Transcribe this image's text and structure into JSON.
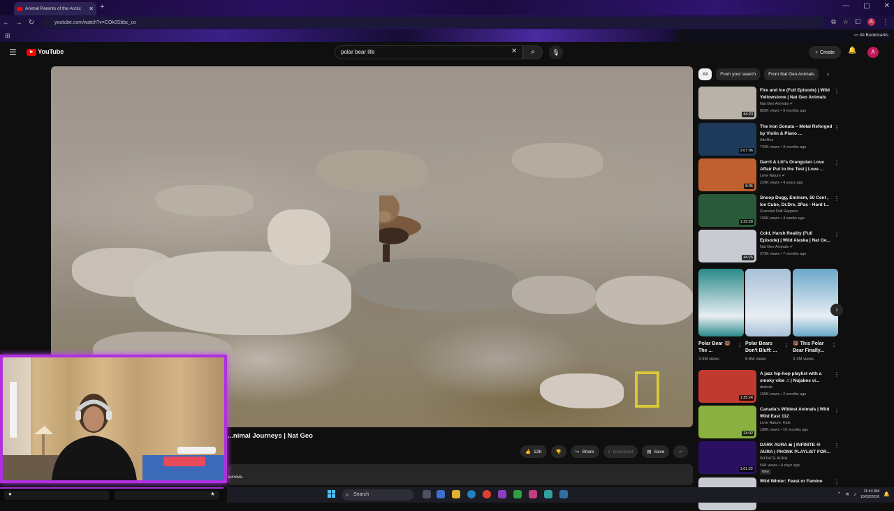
{
  "browser": {
    "tab_title": "Animal Parents of the Arctic",
    "url": "youtube.com/watch?v=COk0Sbbc_co",
    "bookmarks_label": "All Bookmarks",
    "profile_initial": "A"
  },
  "header": {
    "logo_text": "YouTube",
    "search_value": "polar bear life",
    "create_label": "Create",
    "avatar_initial": "A"
  },
  "video": {
    "title": "...nimal Journeys | Nat Geo",
    "likes": "13K",
    "share_label": "Share",
    "download_label": "Download",
    "save_label": "Save",
    "description_snippet": "survive."
  },
  "chips": [
    "All",
    "From your search",
    "From Nat Geo Animals"
  ],
  "recommendations": [
    {
      "title": "Fire and Ice (Full Episode) | Wild Yellowstone | Nat Geo Animals",
      "channel": "Nat Geo Animals ✔",
      "meta": "855K views • 9 months ago",
      "duration": "44:23",
      "thumb_color": "#b8b2a8"
    },
    {
      "title": "The Iron Sonata – Metal Reforged by Violin & Piano ...",
      "channel": "AltoRox",
      "meta": "743K views • 3 months ago",
      "duration": "2:07:06",
      "thumb_color": "#1e3a5a"
    },
    {
      "title": "Darril & Liti's Orangutan Love Affair Put to the Test | Love ...",
      "channel": "Love Nature ✔",
      "meta": "229K views • 4 years ago",
      "duration": "8:05",
      "thumb_color": "#c06030"
    },
    {
      "title": "Snoop Dogg, Eminem, 50 Cent , Ice Cube, Dr.Dre, 2Pac - Hard t...",
      "channel": "Grandad Drill Rappers",
      "meta": "156K views • 4 weeks ago",
      "duration": "1:33:29",
      "thumb_color": "#2a5a3a"
    },
    {
      "title": "Cold, Harsh Reality (Full Episode) | Wild Alaska | Nat Ge...",
      "channel": "Nat Geo Animals ✔",
      "meta": "373K views • 7 months ago",
      "duration": "44:25",
      "thumb_color": "#c8ccd2"
    },
    {
      "title": "A jazz hip-hop playlist with a smoky vibe ♫ | Nujabes vi...",
      "channel": "dndosb",
      "meta": "155K views • 2 months ago",
      "duration": "1:35:24",
      "thumb_color": "#c03a30"
    },
    {
      "title": "Canada's Wildest Animals | Wild Wild East 112",
      "channel": "Love Nature: Kids",
      "meta": "189K views • 10 months ago",
      "duration": "24:02",
      "thumb_color": "#8ab040"
    },
    {
      "title": "DARK AURA ☠ | INFINITE ♾ AURA | PHONK PLAYLIST FOR...",
      "channel": "INFINITE AURA",
      "meta": "54K views • 4 days ago",
      "duration": "1:01:22",
      "badge": "New",
      "thumb_color": "#2a1060"
    },
    {
      "title": "Wild Winter: Feast or Famine",
      "channel": "",
      "meta": "",
      "duration": "",
      "thumb_color": "#c8ccd2"
    }
  ],
  "shorts": [
    {
      "title": "Polar Bear 🐻 The ...",
      "views": "3.3M views",
      "color": "#2a8a8a"
    },
    {
      "title": "Polar Bears Don't Bluff: ...",
      "views": "6.6M views",
      "color": "#a8c0d8"
    },
    {
      "title": "🐻 This Polar Bear Finally...",
      "views": "3.1M views",
      "color": "#6aa8c8"
    }
  ],
  "taskbar": {
    "search_label": "Search",
    "time": "11:44 AM",
    "date": "18/02/2026"
  }
}
